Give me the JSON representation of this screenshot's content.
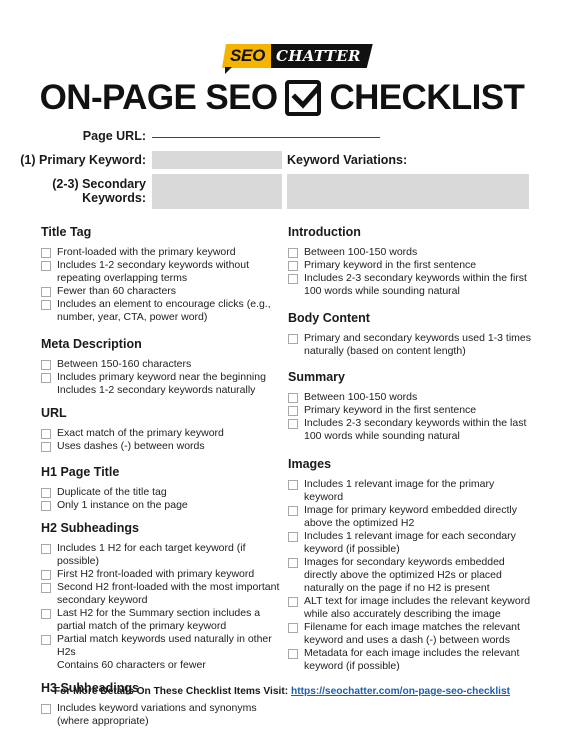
{
  "logo": {
    "part1": "SEO",
    "part2": "CHATTER",
    "brand_color": "#f5b400"
  },
  "title": {
    "left": "ON-PAGE SEO",
    "icon": "checkbox-checked-icon",
    "right": "CHECKLIST"
  },
  "form": {
    "page_url_label": "Page URL:",
    "primary_keyword_label": "(1) Primary Keyword:",
    "keyword_variations_label": "Keyword Variations:",
    "secondary_keywords_label_line1": "(2-3) Secondary",
    "secondary_keywords_label_line2": "Keywords:",
    "page_url_value": "",
    "primary_keyword_value": "",
    "secondary_keywords_value": "",
    "keyword_variations_value": ""
  },
  "left_sections": [
    {
      "heading": "Title Tag",
      "items": [
        {
          "text": "Front-loaded with the primary keyword",
          "checkbox": true
        },
        {
          "text": "Includes 1-2 secondary keywords without repeating overlapping terms",
          "checkbox": true
        },
        {
          "text": "Fewer than 60 characters",
          "checkbox": true
        },
        {
          "text": "Includes an element to encourage clicks (e.g., number, year, CTA, power word)",
          "checkbox": true
        }
      ]
    },
    {
      "heading": "Meta Description",
      "items": [
        {
          "text": "Between 150-160 characters",
          "checkbox": true
        },
        {
          "text": "Includes primary keyword near the beginning",
          "checkbox": true
        },
        {
          "text": "Includes 1-2 secondary keywords naturally",
          "checkbox": false
        }
      ]
    },
    {
      "heading": "URL",
      "items": [
        {
          "text": "Exact match of the primary keyword",
          "checkbox": true
        },
        {
          "text": "Uses dashes (-) between words",
          "checkbox": true
        }
      ]
    },
    {
      "heading": "H1 Page Title",
      "items": [
        {
          "text": "Duplicate of the title tag",
          "checkbox": true
        },
        {
          "text": "Only 1 instance on the page",
          "checkbox": true
        }
      ]
    },
    {
      "heading": "H2 Subheadings",
      "items": [
        {
          "text": "Includes 1 H2 for each target keyword (if possible)",
          "checkbox": true
        },
        {
          "text": "First H2 front-loaded with primary keyword",
          "checkbox": true
        },
        {
          "text": "Second H2 front-loaded with the most important secondary keyword",
          "checkbox": true
        },
        {
          "text": "Last H2 for the Summary section includes a partial match of the primary keyword",
          "checkbox": true
        },
        {
          "text": "Partial match keywords used naturally in other H2s",
          "checkbox": true
        },
        {
          "text": "Contains 60 characters or fewer",
          "checkbox": false
        }
      ]
    },
    {
      "heading": "H3 Subheadings",
      "items": [
        {
          "text": "Includes keyword variations and synonyms (where appropriate)",
          "checkbox": true
        }
      ]
    }
  ],
  "right_sections": [
    {
      "heading": "Introduction",
      "items": [
        {
          "text": "Between 100-150 words",
          "checkbox": true
        },
        {
          "text": "Primary keyword in the first sentence",
          "checkbox": true
        },
        {
          "text": "Includes 2-3 secondary keywords within the first 100 words while sounding natural",
          "checkbox": true
        }
      ]
    },
    {
      "heading": "Body Content",
      "items": [
        {
          "text": "Primary and secondary keywords used 1-3 times naturally (based on content length)",
          "checkbox": true
        }
      ]
    },
    {
      "heading": "Summary",
      "items": [
        {
          "text": "Between 100-150 words",
          "checkbox": true
        },
        {
          "text": "Primary keyword in the first sentence",
          "checkbox": true
        },
        {
          "text": "Includes 2-3 secondary keywords within the last 100 words while sounding natural",
          "checkbox": true
        }
      ]
    },
    {
      "heading": "Images",
      "items": [
        {
          "text": "Includes 1 relevant image for the primary keyword",
          "checkbox": true
        },
        {
          "text": "Image for primary keyword embedded directly above the optimized H2",
          "checkbox": true
        },
        {
          "text": "Includes 1 relevant image for each secondary keyword (if possible)",
          "checkbox": true
        },
        {
          "text": "Images for secondary keywords embedded directly above the optimized H2s or placed naturally on the page if no H2 is present",
          "checkbox": true
        },
        {
          "text": "ALT text for image includes the relevant keyword while also accurately describing the image",
          "checkbox": true
        },
        {
          "text": "Filename for each image matches the relevant keyword and uses a dash (-) between words",
          "checkbox": true
        },
        {
          "text": "Metadata for each image includes the relevant keyword (if possible)",
          "checkbox": true
        }
      ]
    }
  ],
  "footer": {
    "text": "For More Details On These Checklist Items Visit: ",
    "link_text": "https://seochatter.com/on-page-seo-checklist",
    "link_color": "#1a5fb4"
  }
}
